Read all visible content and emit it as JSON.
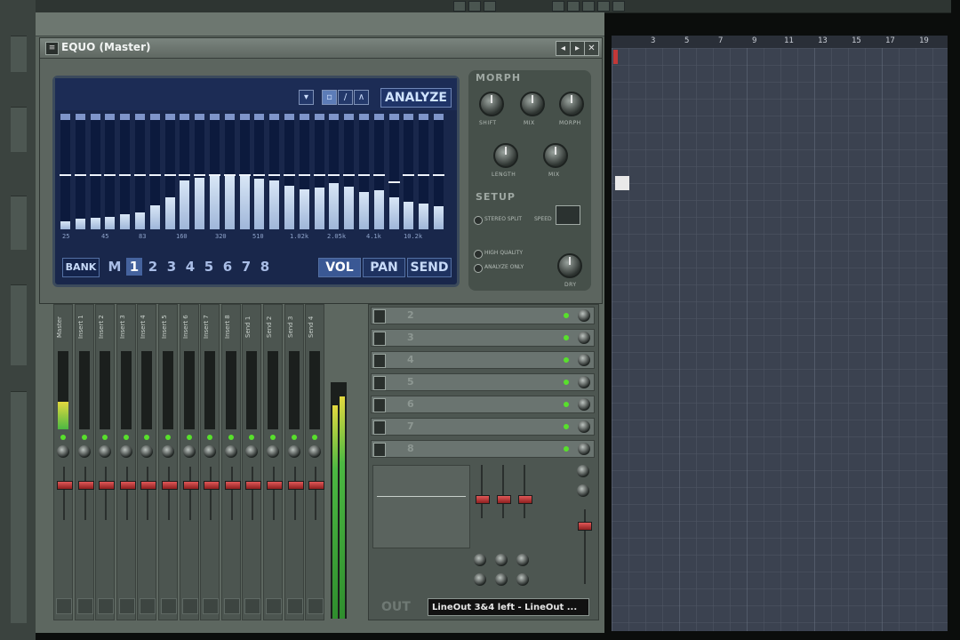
{
  "equo": {
    "title": "EQUO (Master)",
    "analyze_label": "ANALYZE",
    "bank_label": "BANK",
    "bank_m_label": "M",
    "bank_numbers": [
      "1",
      "2",
      "3",
      "4",
      "5",
      "6",
      "7",
      "8"
    ],
    "selected_bank": "1",
    "modes": [
      "VOL",
      "PAN",
      "SEND"
    ],
    "selected_mode": "VOL",
    "freq_labels": [
      "25",
      "45",
      "83",
      "160",
      "320",
      "510",
      "1.02k",
      "2.05k",
      "4.1k",
      "10.2k"
    ],
    "band_levels": [
      0.07,
      0.09,
      0.1,
      0.11,
      0.13,
      0.15,
      0.21,
      0.28,
      0.42,
      0.45,
      0.46,
      0.47,
      0.46,
      0.44,
      0.42,
      0.38,
      0.35,
      0.36,
      0.4,
      0.37,
      0.32,
      0.34,
      0.28,
      0.24,
      0.22,
      0.2
    ],
    "band_lines": [
      0.46,
      0.46,
      0.46,
      0.46,
      0.46,
      0.46,
      0.46,
      0.46,
      0.46,
      0.46,
      0.46,
      0.46,
      0.46,
      0.46,
      0.46,
      0.46,
      0.46,
      0.46,
      0.46,
      0.46,
      0.46,
      0.46,
      0.4,
      0.46,
      0.46,
      0.46
    ]
  },
  "morph": {
    "head": "MORPH",
    "knob_labels": [
      "SHIFT",
      "MIX",
      "MORPH",
      "LENGTH",
      "MIX"
    ]
  },
  "setup": {
    "head": "SETUP",
    "opt_1": "STEREO SPLIT",
    "opt_2": "SPEED",
    "opt_3": "HIGH QUALITY",
    "opt_4": "ANALYZE ONLY",
    "knob_label": "DRY"
  },
  "mixer": {
    "channels": [
      "Master",
      "Insert 1",
      "Insert 2",
      "Insert 3",
      "Insert 4",
      "Insert 5",
      "Insert 6",
      "Insert 7",
      "Insert 8",
      "Send 1",
      "Send 2",
      "Send 3",
      "Send 4"
    ],
    "channel_levels": [
      0.35,
      0,
      0,
      0,
      0,
      0,
      0,
      0,
      0,
      0,
      0,
      0,
      0
    ],
    "fx_slot_numbers": [
      "2",
      "3",
      "4",
      "5",
      "6",
      "7",
      "8"
    ],
    "output_label": "LineOut 3&4 left - LineOut ...",
    "out_text": "OUT"
  },
  "playlist": {
    "bar_numbers": [
      "3",
      "5",
      "7",
      "9",
      "11",
      "13",
      "15",
      "17",
      "19"
    ]
  },
  "colors": {
    "eq_bg": "#19274b",
    "accent": "#6f86b6",
    "meter_green": "#4cb842",
    "fader_red": "#e05757"
  }
}
